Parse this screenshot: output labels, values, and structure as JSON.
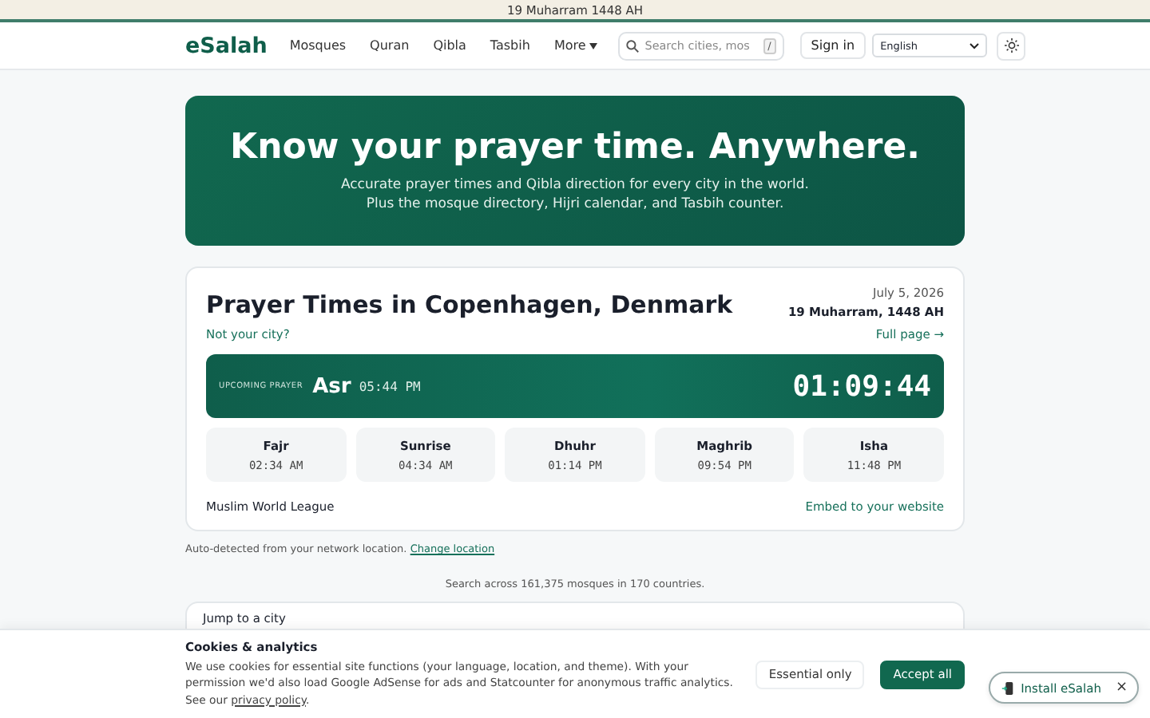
{
  "top_banner": "19 Muharram 1448 AH",
  "nav": {
    "logo": "eSalah",
    "links": [
      {
        "label": "Mosques",
        "kind": "link"
      },
      {
        "label": "Quran",
        "kind": "link"
      },
      {
        "label": "Qibla",
        "kind": "link"
      },
      {
        "label": "Tasbih",
        "kind": "link"
      },
      {
        "label": "More",
        "kind": "menu"
      }
    ],
    "search": {
      "placeholder": "Search cities, mos",
      "shortcut": "/"
    },
    "sign_in": "Sign in",
    "language": "English"
  },
  "hero": {
    "title": "Know your prayer time. Anywhere.",
    "lines": [
      "Accurate prayer times and Qibla direction for every city in the world.",
      "Plus the mosque directory, Hijri calendar, and Tasbih counter."
    ]
  },
  "prayer_card": {
    "title": "Prayer Times in Copenhagen, Denmark",
    "not_your_city": "Not your city?",
    "date": "July 5, 2026",
    "hijri": "19 Muharram, 1448 AH",
    "full_page": "Full page →",
    "upcoming": {
      "label": "UPCOMING PRAYER",
      "name": "Asr",
      "time": "05:44 PM",
      "countdown": "01:09:44"
    },
    "times": [
      {
        "name": "Fajr",
        "time": "02:34 AM"
      },
      {
        "name": "Sunrise",
        "time": "04:34 AM"
      },
      {
        "name": "Dhuhr",
        "time": "01:14 PM"
      },
      {
        "name": "Maghrib",
        "time": "09:54 PM"
      },
      {
        "name": "Isha",
        "time": "11:48 PM"
      }
    ],
    "method": "Muslim World League",
    "embed": "Embed to your website"
  },
  "auto_detected": {
    "text": "Auto-detected from your network location.",
    "link": "Change location"
  },
  "search_note": "Search across 161,375 mosques in 170 countries.",
  "jump_card": {
    "title": "Jump to a city"
  },
  "cookie_banner": {
    "title": "Cookies & analytics",
    "text": "We use cookies for essential site functions (your language, location, and theme). With your permission we'd also load Google AdSense for ads and Statcounter for anonymous traffic analytics. See our",
    "link": "privacy policy",
    "after_link": ".",
    "buttons": [
      {
        "label": "Essential only",
        "kind": "secondary"
      },
      {
        "label": "Accept all",
        "kind": "primary"
      }
    ]
  },
  "install_pill": {
    "label": "Install eSalah",
    "close": "×"
  }
}
